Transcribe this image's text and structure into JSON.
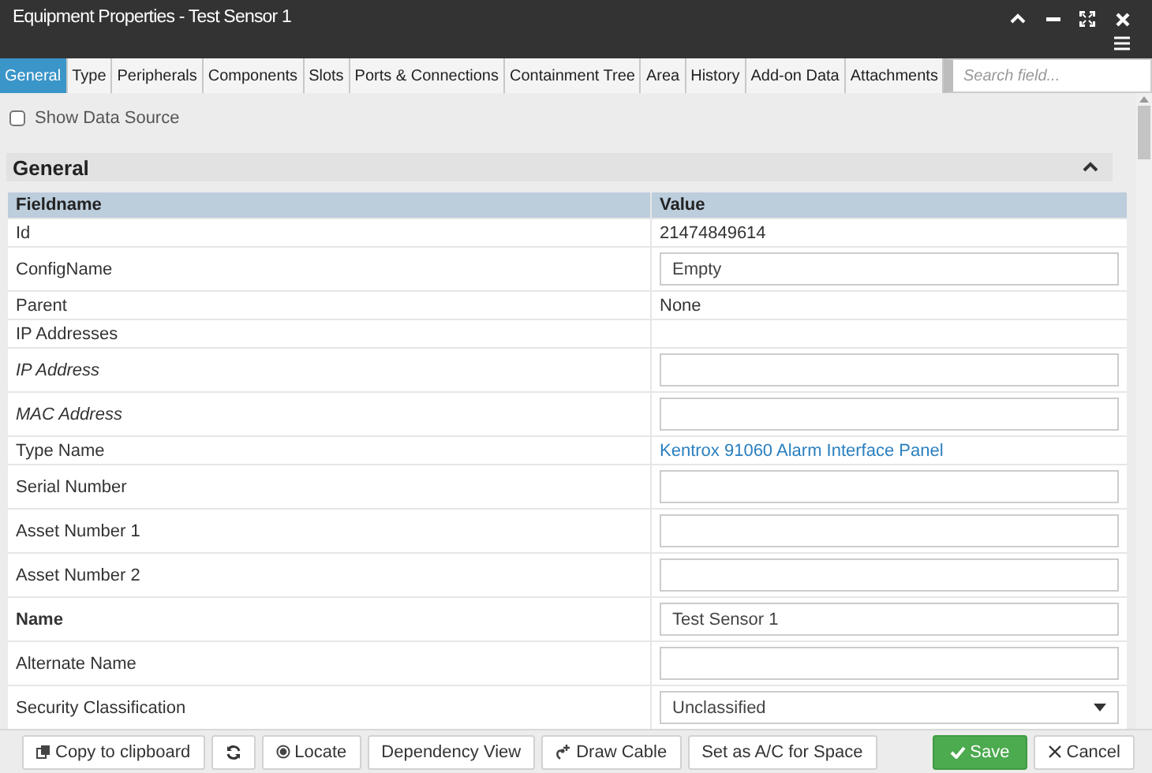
{
  "window": {
    "title": "Equipment Properties - Test Sensor 1"
  },
  "tabs": [
    {
      "label": "General",
      "selected": true
    },
    {
      "label": "Type",
      "selected": false
    },
    {
      "label": "Peripherals",
      "selected": false
    },
    {
      "label": "Components",
      "selected": false
    },
    {
      "label": "Slots",
      "selected": false
    },
    {
      "label": "Ports & Connections",
      "selected": false
    },
    {
      "label": "Containment Tree",
      "selected": false
    },
    {
      "label": "Area",
      "selected": false
    },
    {
      "label": "History",
      "selected": false
    },
    {
      "label": "Add-on Data",
      "selected": false
    },
    {
      "label": "Attachments",
      "selected": false
    }
  ],
  "search": {
    "placeholder": "Search field..."
  },
  "show_data_source": {
    "label": "Show Data Source",
    "checked": false
  },
  "section": {
    "title": "General",
    "expanded": true
  },
  "table": {
    "columns": [
      "Fieldname",
      "Value"
    ],
    "rows": [
      {
        "field": "Id",
        "kind": "text",
        "value": "21474849614"
      },
      {
        "field": "ConfigName",
        "kind": "input",
        "value": "Empty"
      },
      {
        "field": "Parent",
        "kind": "text",
        "value": "None"
      },
      {
        "field": "IP Addresses",
        "kind": "text",
        "value": ""
      },
      {
        "field": "IP Address",
        "kind": "input",
        "value": "",
        "italic": true
      },
      {
        "field": "MAC Address",
        "kind": "input",
        "value": "",
        "italic": true
      },
      {
        "field": "Type Name",
        "kind": "link",
        "value": "Kentrox 91060 Alarm Interface Panel"
      },
      {
        "field": "Serial Number",
        "kind": "input",
        "value": ""
      },
      {
        "field": "Asset Number 1",
        "kind": "input",
        "value": ""
      },
      {
        "field": "Asset Number 2",
        "kind": "input",
        "value": ""
      },
      {
        "field": "Name",
        "kind": "input",
        "value": "Test Sensor 1",
        "bold": true
      },
      {
        "field": "Alternate Name",
        "kind": "input",
        "value": ""
      },
      {
        "field": "Security Classification",
        "kind": "select",
        "value": "Unclassified"
      }
    ]
  },
  "toolbar": [
    {
      "kind": "copy",
      "label": "Copy to clipboard"
    },
    {
      "kind": "refresh"
    },
    {
      "kind": "locate",
      "label": "Locate"
    },
    {
      "kind": "plain",
      "label": "Dependency View"
    },
    {
      "kind": "cable",
      "label": "Draw Cable"
    },
    {
      "kind": "plain",
      "label": "Set as A/C for Space"
    }
  ],
  "actions": [
    {
      "kind": "save",
      "label": "Save"
    },
    {
      "kind": "cancel",
      "label": "Cancel"
    }
  ]
}
